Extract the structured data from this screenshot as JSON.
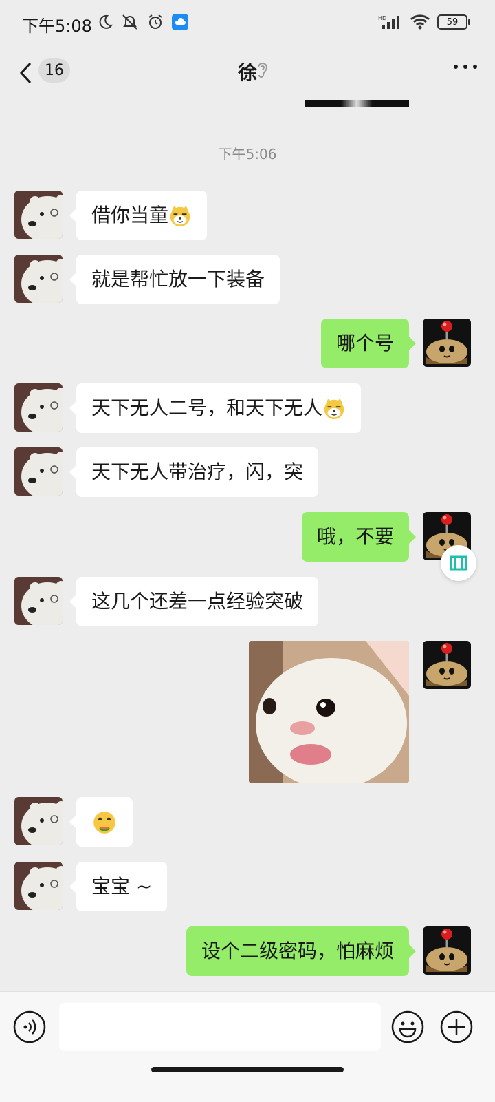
{
  "status_bar": {
    "time": "下午5:08",
    "battery": "59",
    "icons_left": [
      "moon-icon",
      "bell-off-icon",
      "alarm-icon",
      "cloud-app-icon"
    ],
    "icons_right": [
      "hd-signal-icon",
      "wifi-icon",
      "battery-icon"
    ]
  },
  "header": {
    "back_icon": "chevron-left-icon",
    "unread_count": "16",
    "title": "徐",
    "ear_icon": "ear-icon",
    "more_icon": "more-dots-icon"
  },
  "timestamp": "下午5:06",
  "messages": [
    {
      "side": "in",
      "text": "借你当童",
      "emoji": "doge-emoji"
    },
    {
      "side": "in",
      "text": "就是帮忙放一下装备"
    },
    {
      "side": "out",
      "text": "哪个号"
    },
    {
      "side": "in",
      "text": "天下无人二号，和天下无人",
      "emoji": "doge-emoji"
    },
    {
      "side": "in",
      "text": "天下无人带治疗，闪，突"
    },
    {
      "side": "out",
      "text": "哦，不要"
    },
    {
      "side": "in",
      "text": "这几个还差一点经验突破"
    },
    {
      "side": "out",
      "type": "sticker",
      "sticker": "cat-tongue-sticker"
    },
    {
      "side": "in",
      "type": "emoji",
      "emoji": "smirk-hug-emoji"
    },
    {
      "side": "in",
      "text": "宝宝 ~"
    },
    {
      "side": "out",
      "text": "设个二级密码，怕麻烦"
    }
  ],
  "avatars": {
    "incoming": "polar-bear-avatar",
    "outgoing": "potato-mine-avatar"
  },
  "input_bar": {
    "voice_icon": "voice-icon",
    "text_value": "",
    "emoji_icon": "emoji-icon",
    "add_icon": "add-icon"
  },
  "colors": {
    "background": "#ededed",
    "incoming_bubble": "#ffffff",
    "outgoing_bubble": "#95ec69"
  }
}
